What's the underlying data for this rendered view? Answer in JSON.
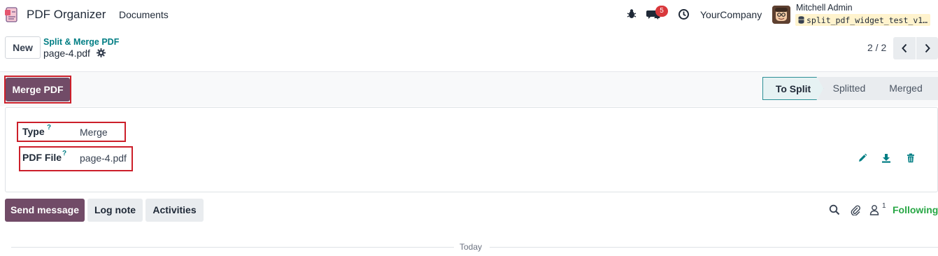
{
  "navbar": {
    "app_name": "PDF Organizer",
    "menu_documents": "Documents",
    "messages_badge": "5",
    "company": "YourCompany",
    "user_name": "Mitchell Admin",
    "database": "split_pdf_widget_test_v1…"
  },
  "control_panel": {
    "new_label": "New",
    "breadcrumb": "Split & Merge PDF",
    "record_name": "page-4.pdf",
    "pager": "2 / 2"
  },
  "statusbar": {
    "action_button": "Merge PDF",
    "stages": [
      "To Split",
      "Splitted",
      "Merged"
    ],
    "active_stage": "To Split"
  },
  "form": {
    "type_label": "Type",
    "type_value": "Merge",
    "pdf_file_label": "PDF File",
    "pdf_file_value": "page-4.pdf",
    "help_mark": "?"
  },
  "chatter": {
    "send_message": "Send message",
    "log_note": "Log note",
    "activities": "Activities",
    "followers_count": "1",
    "following": "Following",
    "date_separator": "Today"
  },
  "colors": {
    "brand": "#714b67",
    "link": "#017e84",
    "highlight": "#cc1f2a",
    "following": "#28a745",
    "badge": "#d9383c"
  }
}
